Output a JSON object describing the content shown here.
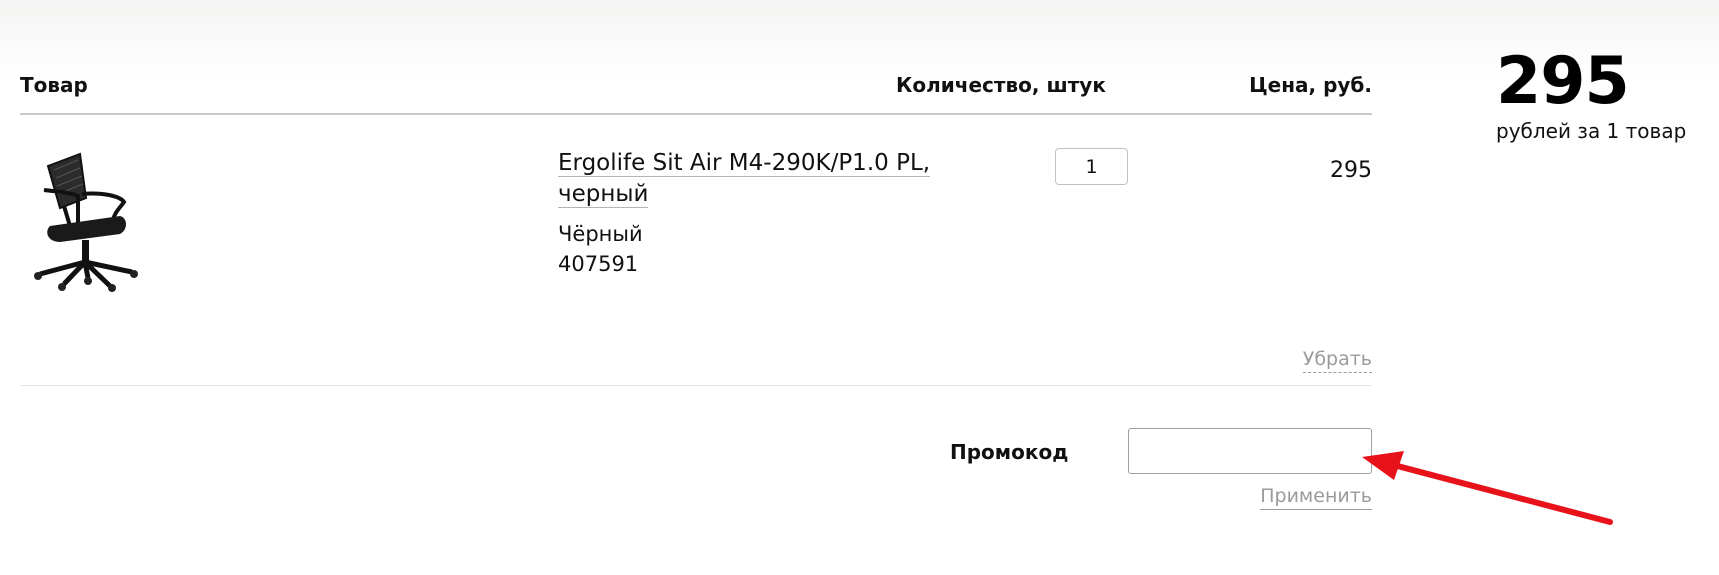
{
  "table_headers": {
    "product": "Товар",
    "quantity": "Количество, штук",
    "price": "Цена, руб."
  },
  "cart_item": {
    "name": "Ergolife Sit Air M4-290K/P1.0 PL, черный",
    "color": "Чёрный",
    "code": "407591",
    "quantity": "1",
    "price": "295",
    "remove_label": "Убрать",
    "image_icon": "office-chair-icon"
  },
  "promo": {
    "label": "Промокод",
    "value": "",
    "placeholder": "",
    "apply_label": "Применить"
  },
  "summary": {
    "total": "295",
    "caption": "рублей за 1 товар"
  },
  "annotation": {
    "arrow_color": "#e8131a"
  }
}
